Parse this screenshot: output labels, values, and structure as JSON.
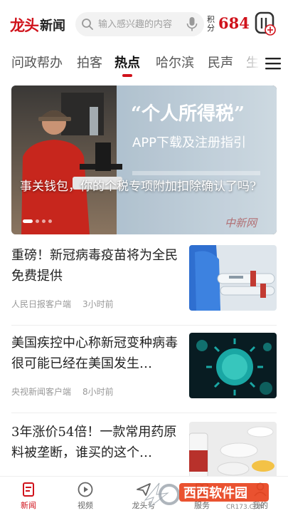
{
  "header": {
    "logo_brand": "龙头",
    "logo_word": "新闻",
    "search_placeholder": "输入感兴趣的内容",
    "points_label": "积分",
    "points_value": "684"
  },
  "tabs": [
    {
      "label": "问政帮办"
    },
    {
      "label": "拍客"
    },
    {
      "label": "热点"
    },
    {
      "label": "哈尔滨"
    },
    {
      "label": "民声"
    },
    {
      "label": "生"
    }
  ],
  "hero": {
    "caption": "事关钱包，你的个税专项附加扣除确认了吗?",
    "poster_line1": "“个人所得税”",
    "poster_line2": "APP下载及注册指引",
    "watermark": "中新网"
  },
  "news": [
    {
      "title": "重磅！新冠病毒疫苗将为全民免费提供",
      "source": "人民日报客户端",
      "time": "3小时前"
    },
    {
      "title": "美国疾控中心称新冠变种病毒很可能已经在美国发生…",
      "source": "央视新闻客户端",
      "time": "8小时前"
    },
    {
      "title": "3年涨价54倍！一款常用药原料被垄断，谁买的这个…",
      "source": "",
      "time": ""
    }
  ],
  "bottom_nav": [
    {
      "label": "新闻"
    },
    {
      "label": "视频"
    },
    {
      "label": "龙头号"
    },
    {
      "label": "服务"
    },
    {
      "label": "我的"
    }
  ],
  "site_watermark": {
    "name": "西西软件园",
    "domain": "CR173.COM"
  },
  "colors": {
    "accent": "#d0121b",
    "text": "#222222",
    "meta": "#999999"
  }
}
